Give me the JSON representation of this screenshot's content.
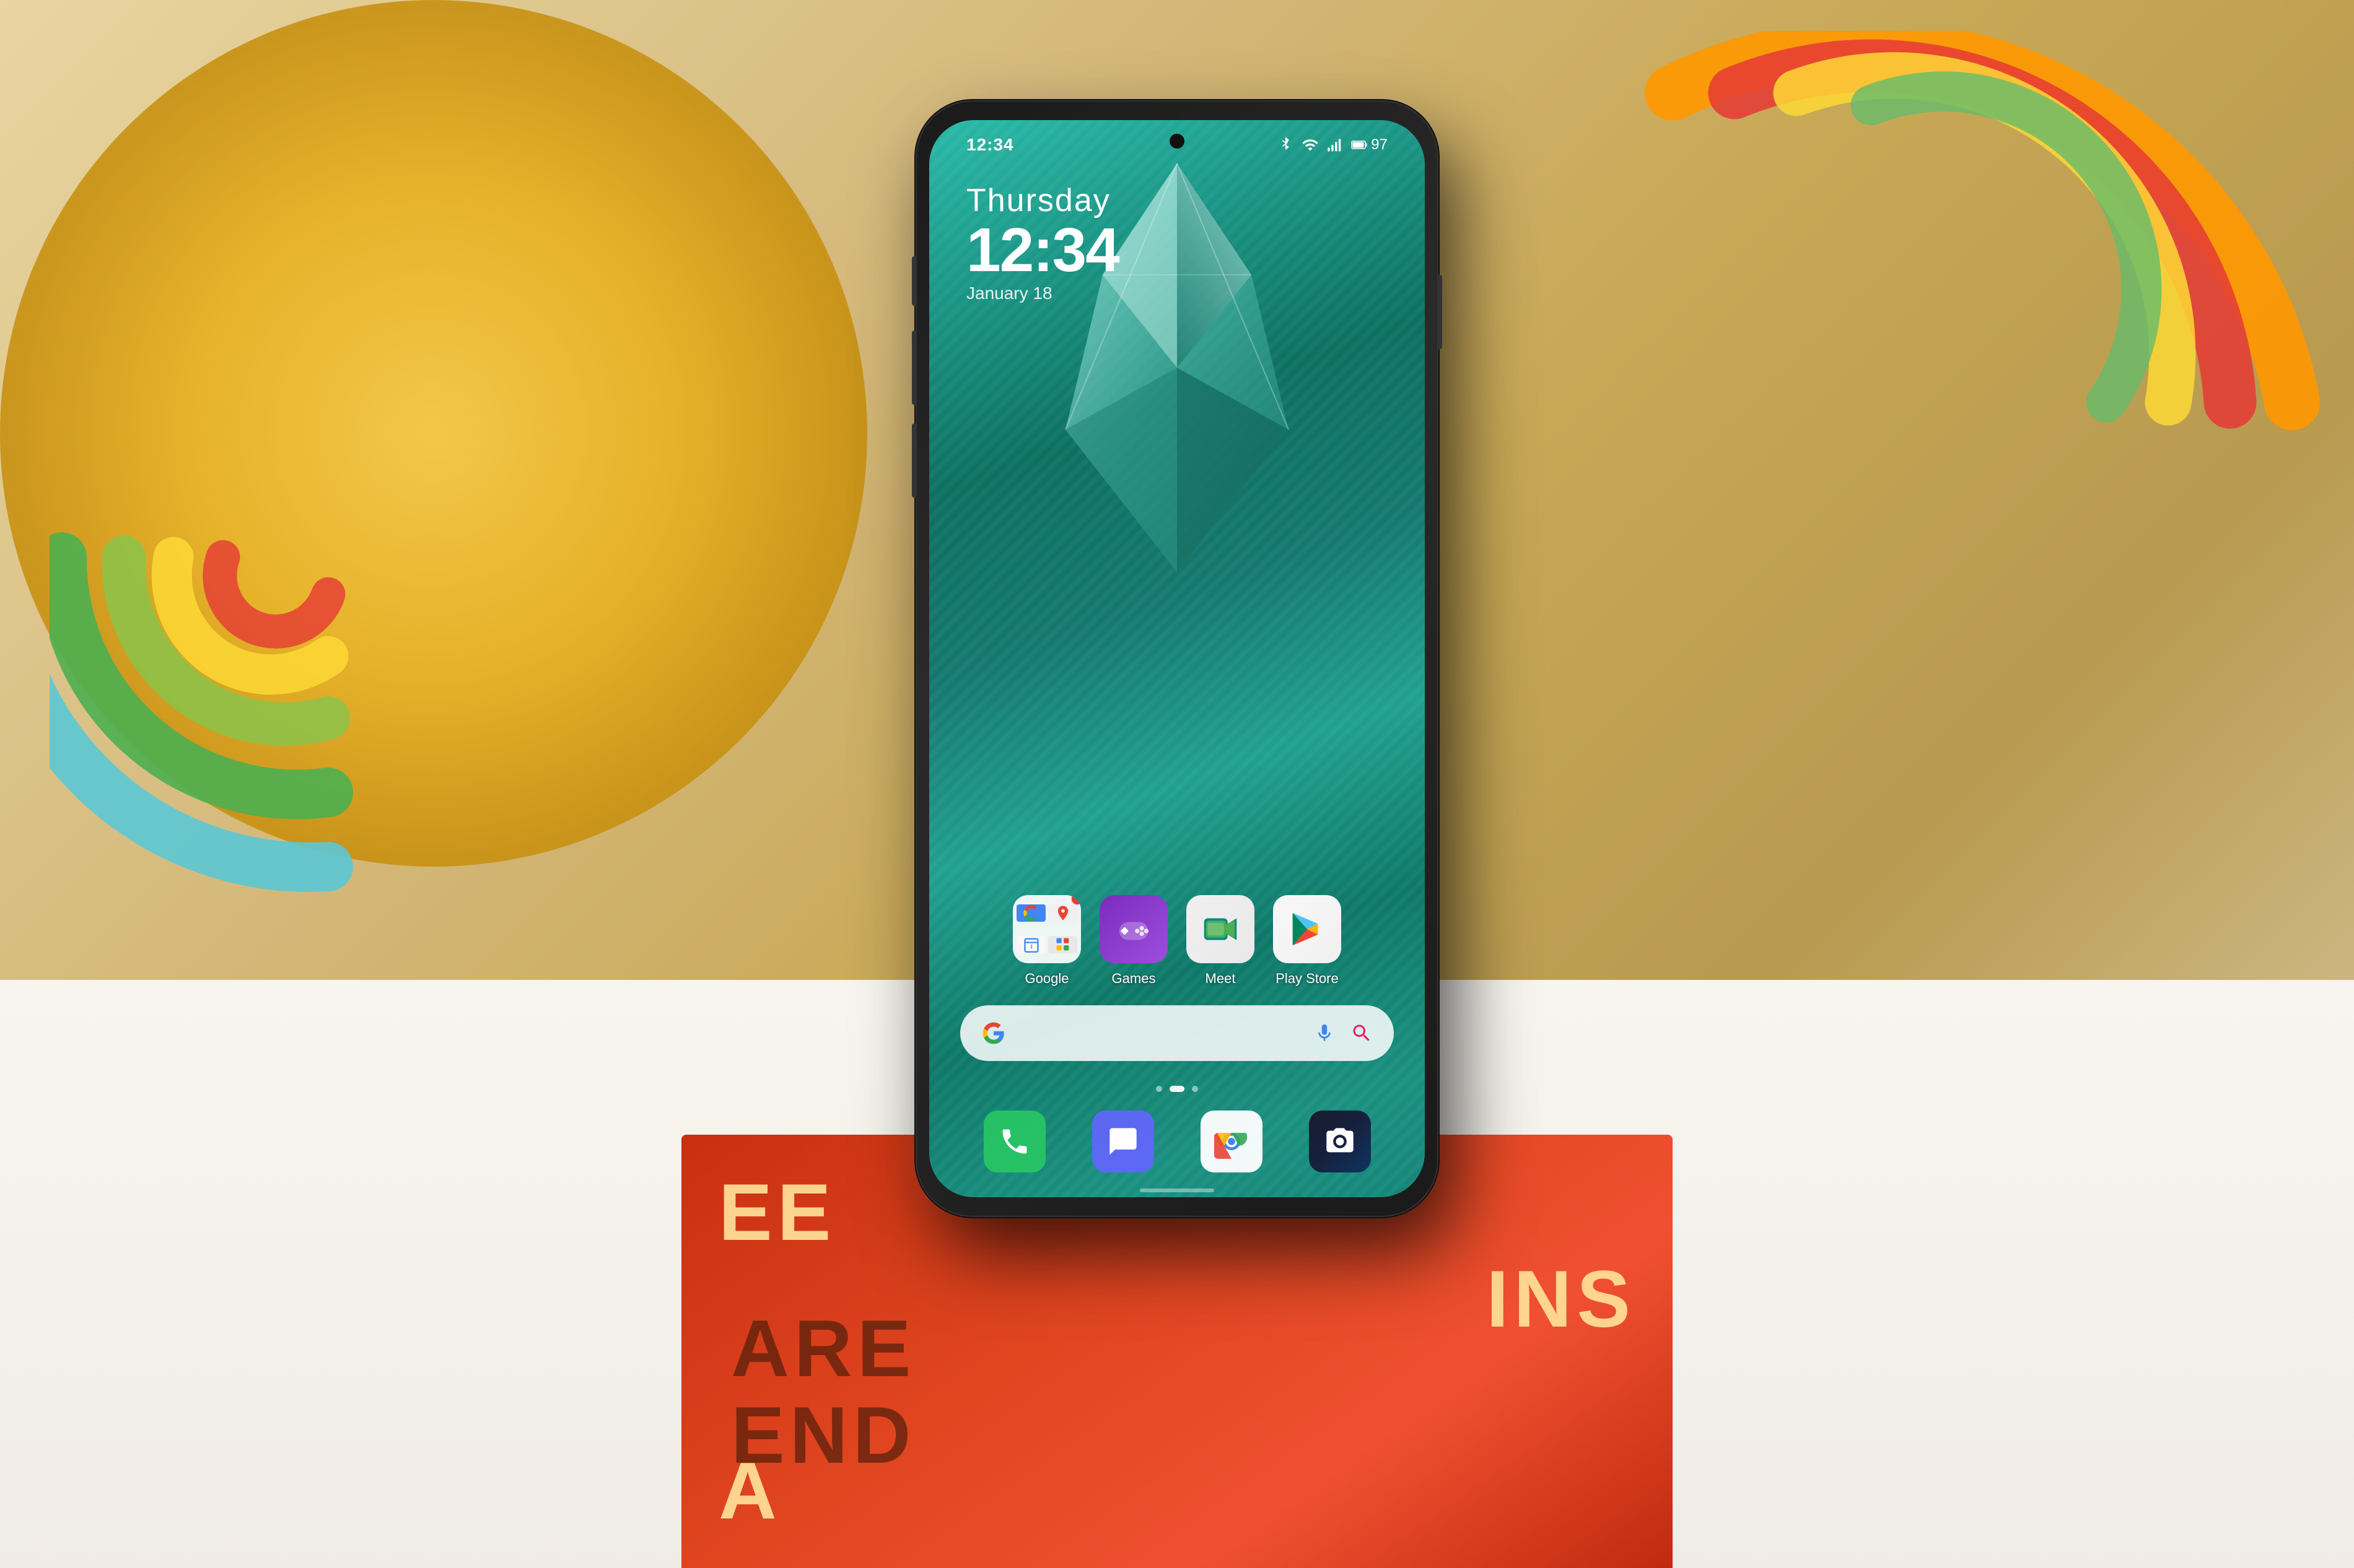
{
  "background": {
    "description": "Colorful photo background with rainbow arcs and table"
  },
  "phone": {
    "status_bar": {
      "time": "12:34",
      "battery": "97",
      "signal_bars": 4,
      "wifi": true,
      "bluetooth": true
    },
    "clock_widget": {
      "day": "Thursday",
      "time": "12:34",
      "date": "January 18"
    },
    "apps": [
      {
        "name": "Google",
        "label": "Google",
        "type": "folder",
        "has_notification": true
      },
      {
        "name": "Games",
        "label": "Games",
        "type": "purple_gaming",
        "has_notification": false
      },
      {
        "name": "Meet",
        "label": "Meet",
        "type": "meet",
        "has_notification": false
      },
      {
        "name": "Play Store",
        "label": "Play Store",
        "type": "playstore",
        "has_notification": false
      }
    ],
    "dock_apps": [
      {
        "name": "Phone",
        "type": "phone"
      },
      {
        "name": "Messages",
        "type": "messages"
      },
      {
        "name": "Chrome",
        "type": "chrome"
      },
      {
        "name": "Camera",
        "type": "camera"
      }
    ],
    "search_bar": {
      "placeholder": "Search"
    },
    "page_dots": 3,
    "active_dot": 1
  }
}
